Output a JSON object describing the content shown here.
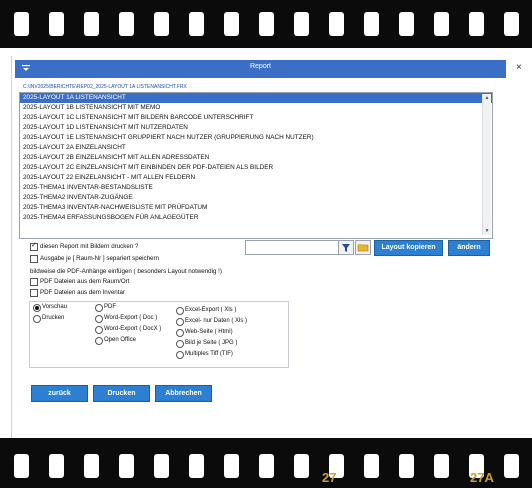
{
  "film_strip": {
    "bottom_frame_numbers": [
      "27",
      "27A"
    ]
  },
  "dialog": {
    "title": "Report",
    "close_label": "×",
    "path": "C:\\INV2025\\BERICHTE\\REP02_2025-LAYOUT 1A LISTENANSICHT.FRX"
  },
  "report_list": {
    "items": [
      "2025-LAYOUT 1A LISTENANSICHT",
      "2025-LAYOUT 1B LISTENANSICHT MIT MEMO",
      "2025-LAYOUT 1C LISTENANSICHT MIT BILDERN  BARCODE UNTERSCHRIFT",
      "2025-LAYOUT 1D LISTENANSICHT MIT NUTZERDATEN",
      "2025-LAYOUT 1E LISTENANSICHT GRUPPIERT NACH NUTZER (GRUPPIERUNG NACH NUTZER)",
      "2025-LAYOUT 2A EINZELANSICHT",
      "2025-LAYOUT 2B EINZELANSICHT MIT ALLEN ADRESSDATEN",
      "2025-LAYOUT 2C EINZELANSICHT MIT EINBINDEN DER PDF-DATEIEN ALS BILDER",
      "2025-LAYOUT 22 EINZELANSICHT - MIT ALLEN FELDERN",
      "2025-THEMA1 INVENTAR-BESTANDSLISTE",
      "2025-THEMA2 INVENTAR-ZUGÄNGE",
      "2025-THEMA3 INVENTAR-NACHWEISLISTE MIT PRÜFDATUM",
      "2025-THEMA4 ERFASSUNGSBOGEN FÜR ANLAGEGÜTER"
    ],
    "selected_index": 0
  },
  "options": {
    "print_with_images": "diesen Report mit Bildern drucken ?",
    "separate_per_room": "Ausgabe je [ Raum-Nr ] separiert speichern",
    "pdf_note": "bildweise die PDF-Anhänge einfügen ( besonders Layout notwendig !)",
    "pdf_room": "PDF Dateien aus dem Raum/Ort",
    "pdf_inventory": "PDF Dateien aus dem Inventar"
  },
  "filter": {
    "value": "",
    "filter_icon": "funnel-icon",
    "folder_icon": "folder-icon"
  },
  "buttons": {
    "copy_layout": "Layout kopieren",
    "change": "ändern",
    "back": "zurück",
    "print": "Drucken",
    "cancel": "Abbrechen"
  },
  "output": {
    "mode_options": [
      "Vorschau",
      "Drucken"
    ],
    "mode_selected": 0,
    "format_options_col1": [
      "PDF",
      "Word-Export ( Doc )",
      "Word-Export ( DocX )",
      "Open Office"
    ],
    "format_options_col2": [
      "Excel-Export ( Xls )",
      "Excel- nur Daten ( Xls )",
      "Web-Seite ( Html)",
      "Bild je Seite (  JPG )",
      "Multiples Tiff  (TIF)"
    ]
  },
  "colors": {
    "accent": "#3b6fc7",
    "button": "#2d7fd1",
    "film_number": "#c9a227"
  }
}
